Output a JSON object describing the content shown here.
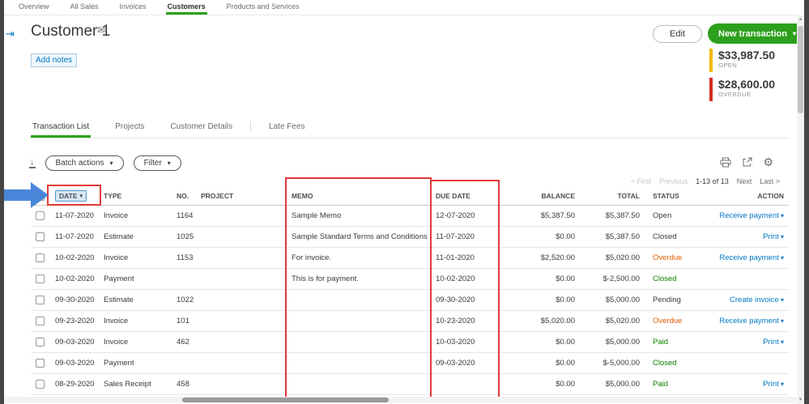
{
  "colors": {
    "brand_green": "#2ca01c",
    "link_blue": "#0077c5",
    "status_overdue": "#e05e00",
    "status_paid": "#108000",
    "open_bar": "#f5b800",
    "overdue_bar": "#d52b1e",
    "annotation_red": "#e03a3a",
    "annotation_blue": "#4a86d8"
  },
  "icons": {
    "caret_down": "▾",
    "envelope": "✉",
    "gear": "⚙",
    "collapse": "⇥",
    "export_list": "↓",
    "scroll_up": "▲",
    "scroll_down": "▼"
  },
  "top_nav": {
    "tabs": [
      {
        "label": "Overview",
        "active": false
      },
      {
        "label": "All Sales",
        "active": false
      },
      {
        "label": "Invoices",
        "active": false
      },
      {
        "label": "Customers",
        "active": true
      },
      {
        "label": "Products and Services",
        "active": false
      }
    ]
  },
  "header": {
    "customer_name": "Customer 1",
    "add_notes_link": "Add notes",
    "edit_button": "Edit",
    "new_transaction_button": "New transaction",
    "summary": {
      "open_amount": "$33,987.50",
      "open_label": "OPEN",
      "overdue_amount": "$28,600.00",
      "overdue_label": "OVERDUE"
    }
  },
  "section_tabs": [
    {
      "label": "Transaction List",
      "active": true,
      "divider_before": false
    },
    {
      "label": "Projects",
      "active": false,
      "divider_before": false
    },
    {
      "label": "Customer Details",
      "active": false,
      "divider_before": false
    },
    {
      "label": "Late Fees",
      "active": false,
      "divider_before": true
    }
  ],
  "toolbar": {
    "batch_actions_label": "Batch actions",
    "filter_label": "Filter"
  },
  "pagination": {
    "first": "< First",
    "previous": "Previous",
    "range": "1-13 of 13",
    "next": "Next",
    "last": "Last >"
  },
  "table": {
    "columns": [
      "DATE",
      "TYPE",
      "NO.",
      "PROJECT",
      "MEMO",
      "DUE DATE",
      "BALANCE",
      "TOTAL",
      "STATUS",
      "ACTION"
    ],
    "sorted_column": "DATE",
    "rows": [
      {
        "date": "11-07-2020",
        "type": "Invoice",
        "no": "1164",
        "project": "",
        "memo": "Sample Memo",
        "due_date": "12-07-2020",
        "balance": "$5,387.50",
        "total": "$5,387.50",
        "status": "Open",
        "status_style": "default",
        "action": "Receive payment"
      },
      {
        "date": "11-07-2020",
        "type": "Estimate",
        "no": "1025",
        "project": "",
        "memo": "Sample Standard Terms and Conditions (T&Cs) t...",
        "due_date": "11-07-2020",
        "balance": "$0.00",
        "total": "$5,387.50",
        "status": "Closed",
        "status_style": "default",
        "action": "Print"
      },
      {
        "date": "10-02-2020",
        "type": "Invoice",
        "no": "1153",
        "project": "",
        "memo": "For invoice.",
        "due_date": "11-01-2020",
        "balance": "$2,520.00",
        "total": "$5,020.00",
        "status": "Overdue",
        "status_style": "overdue",
        "action": "Receive payment"
      },
      {
        "date": "10-02-2020",
        "type": "Payment",
        "no": "",
        "project": "",
        "memo": "This is for payment.",
        "due_date": "10-02-2020",
        "balance": "$0.00",
        "total": "$-2,500.00",
        "status": "Closed",
        "status_style": "paid",
        "action": ""
      },
      {
        "date": "09-30-2020",
        "type": "Estimate",
        "no": "1022",
        "project": "",
        "memo": "",
        "due_date": "09-30-2020",
        "balance": "$0.00",
        "total": "$5,000.00",
        "status": "Pending",
        "status_style": "default",
        "action": "Create invoice"
      },
      {
        "date": "09-23-2020",
        "type": "Invoice",
        "no": "101",
        "project": "",
        "memo": "",
        "due_date": "10-23-2020",
        "balance": "$5,020.00",
        "total": "$5,020.00",
        "status": "Overdue",
        "status_style": "overdue",
        "action": "Receive payment"
      },
      {
        "date": "09-03-2020",
        "type": "Invoice",
        "no": "462",
        "project": "",
        "memo": "",
        "due_date": "10-03-2020",
        "balance": "$0.00",
        "total": "$5,000.00",
        "status": "Paid",
        "status_style": "paid",
        "action": "Print"
      },
      {
        "date": "09-03-2020",
        "type": "Payment",
        "no": "",
        "project": "",
        "memo": "",
        "due_date": "09-03-2020",
        "balance": "$0.00",
        "total": "$-5,000.00",
        "status": "Closed",
        "status_style": "paid",
        "action": ""
      },
      {
        "date": "08-29-2020",
        "type": "Sales Receipt",
        "no": "458",
        "project": "",
        "memo": "",
        "due_date": "",
        "balance": "$0.00",
        "total": "$5,000.00",
        "status": "Paid",
        "status_style": "paid",
        "action": "Print"
      }
    ]
  }
}
